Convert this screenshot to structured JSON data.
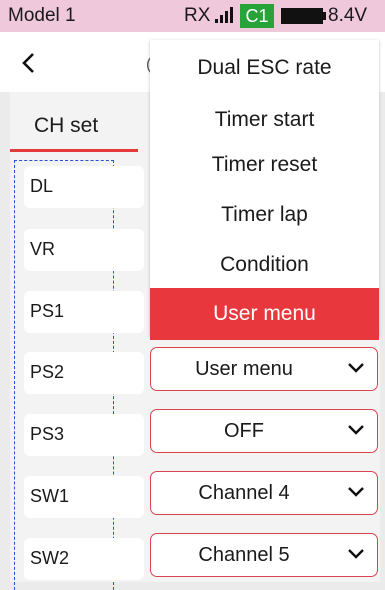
{
  "status": {
    "model": "Model 1",
    "rx": "RX",
    "channel": "C1",
    "voltage": "8.4V",
    "colors": {
      "bar": "#f0c8dc",
      "badge": "#27a33a"
    }
  },
  "nav": {
    "back_icon": "chevron-left-icon",
    "partial_title": "("
  },
  "tabs": {
    "active": "CH set"
  },
  "rows": [
    {
      "label": "DL"
    },
    {
      "label": "VR"
    },
    {
      "label": "PS1"
    },
    {
      "label": "PS2",
      "value": "User menu"
    },
    {
      "label": "PS3",
      "value": "OFF"
    },
    {
      "label": "SW1",
      "value": "Channel 4"
    },
    {
      "label": "SW2",
      "value": "Channel 5"
    }
  ],
  "dropdown": {
    "options": [
      "Dual ESC rate",
      "Timer start",
      "Timer reset",
      "Timer lap",
      "Condition",
      "User menu"
    ],
    "selected": "User menu",
    "accent": "#e8383d"
  }
}
